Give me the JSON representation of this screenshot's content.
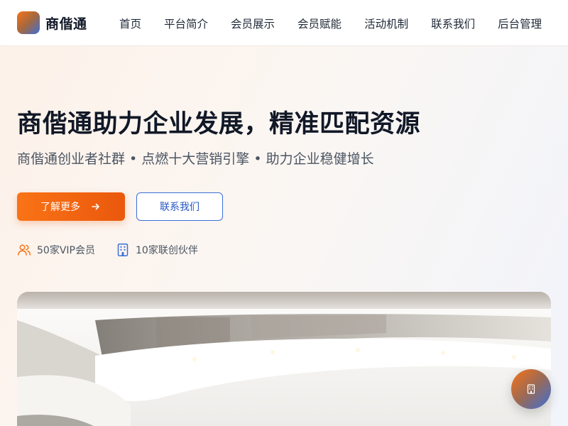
{
  "brand": {
    "name": "商偕通"
  },
  "nav": {
    "items": [
      {
        "label": "首页"
      },
      {
        "label": "平台简介"
      },
      {
        "label": "会员展示"
      },
      {
        "label": "会员赋能"
      },
      {
        "label": "活动机制"
      },
      {
        "label": "联系我们"
      },
      {
        "label": "后台管理"
      }
    ]
  },
  "hero": {
    "title": "商偕通助力企业发展，精准匹配资源",
    "subtitle": "商偕通创业者社群 • 点燃十大营销引擎 • 助力企业稳健增长",
    "primary_button": "了解更多",
    "secondary_button": "联系我们",
    "stats": [
      {
        "text": "50家VIP会员",
        "icon": "users-icon"
      },
      {
        "text": "10家联创伙伴",
        "icon": "building-icon"
      }
    ]
  },
  "colors": {
    "accent_orange": "#f97316",
    "accent_blue": "#3b6fd8"
  },
  "icons": {
    "primary_button": "arrow-right-icon",
    "fab": "building-icon"
  }
}
